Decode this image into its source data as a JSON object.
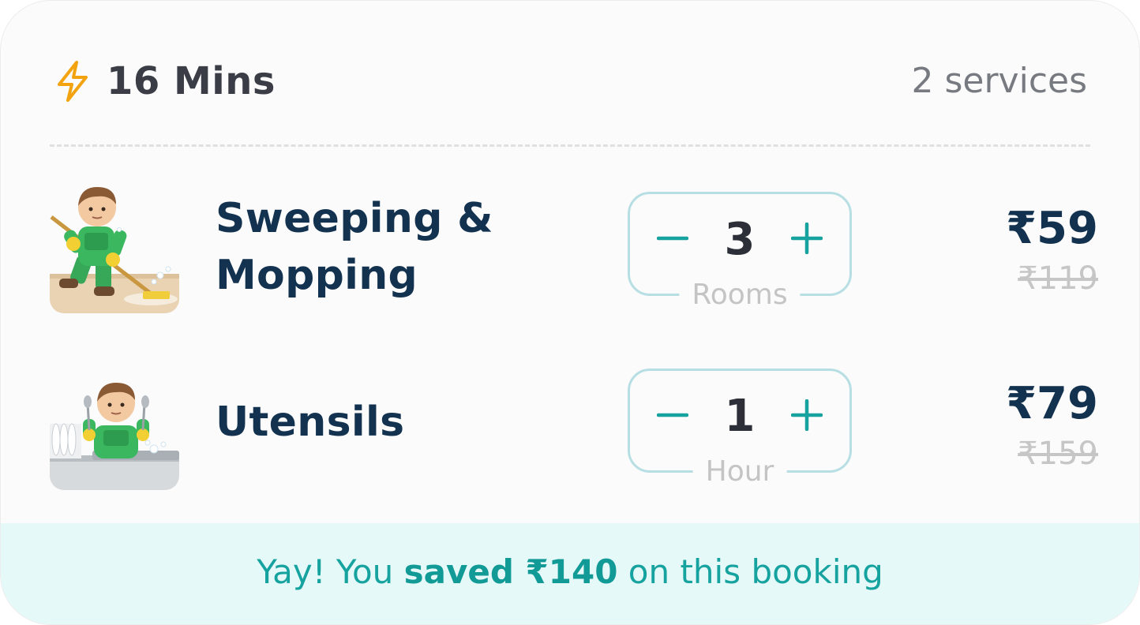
{
  "header": {
    "eta": "16 Mins",
    "eta_icon": "lightning-bolt-icon",
    "services_count": "2 services"
  },
  "services": [
    {
      "name": "Sweeping & Mopping",
      "image": "sweeping-mopping-illustration",
      "quantity": "3",
      "unit": "Rooms",
      "price": "₹59",
      "original_price": "₹119"
    },
    {
      "name": "Utensils",
      "image": "utensils-dishwashing-illustration",
      "quantity": "1",
      "unit": "Hour",
      "price": "₹79",
      "original_price": "₹159"
    }
  ],
  "savings": {
    "prefix": "Yay! You ",
    "highlight": "saved ₹140",
    "suffix": " on this booking"
  },
  "colors": {
    "accent": "#16a3a0",
    "bolt": "#f2a30f",
    "heading": "#13324f",
    "stepper_border": "#b7dfe3",
    "savings_bg": "#e5f9f8"
  }
}
